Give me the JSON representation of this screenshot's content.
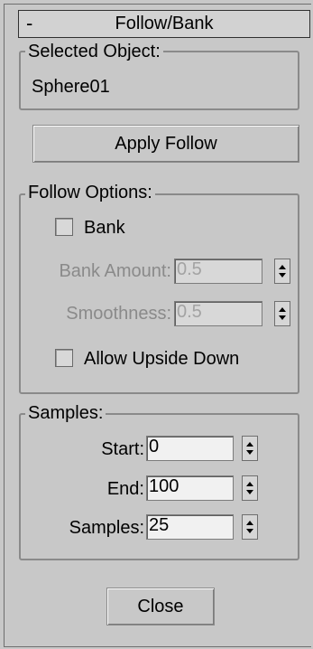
{
  "rollout": {
    "collapse_symbol": "-",
    "title": "Follow/Bank"
  },
  "selected_object": {
    "legend": "Selected Object:",
    "value": "Sphere01"
  },
  "apply_follow_label": "Apply Follow",
  "follow_options": {
    "legend": "Follow Options:",
    "bank_label": "Bank",
    "bank_checked": false,
    "bank_amount_label": "Bank Amount:",
    "bank_amount_value": "0.5",
    "smoothness_label": "Smoothness:",
    "smoothness_value": "0.5",
    "allow_upside_down_label": "Allow Upside Down",
    "allow_upside_down_checked": false
  },
  "samples": {
    "legend": "Samples:",
    "start_label": "Start:",
    "start_value": "0",
    "end_label": "End:",
    "end_value": "100",
    "samples_label": "Samples:",
    "samples_value": "25"
  },
  "close_label": "Close"
}
